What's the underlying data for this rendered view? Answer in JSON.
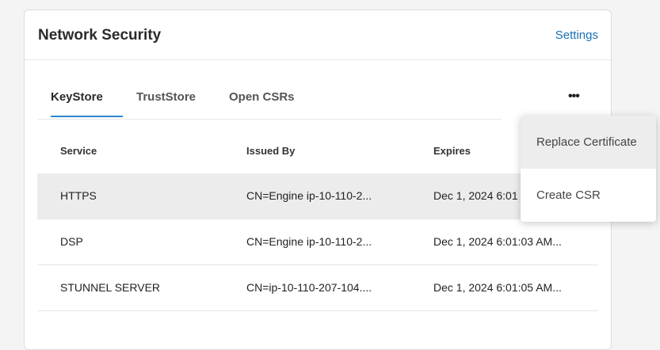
{
  "card": {
    "title": "Network Security",
    "settings_label": "Settings"
  },
  "tabs": [
    {
      "label": "KeyStore",
      "active": true
    },
    {
      "label": "TrustStore",
      "active": false
    },
    {
      "label": "Open CSRs",
      "active": false
    }
  ],
  "more_icon": "more-horizontal-icon",
  "table": {
    "columns": [
      "Service",
      "Issued By",
      "Expires"
    ],
    "rows": [
      {
        "service": "HTTPS",
        "issued_by": "CN=Engine ip-10-110-2...",
        "expires": "Dec 1, 2024 6:01"
      },
      {
        "service": "DSP",
        "issued_by": "CN=Engine ip-10-110-2...",
        "expires": "Dec 1, 2024 6:01:03 AM..."
      },
      {
        "service": "STUNNEL SERVER",
        "issued_by": "CN=ip-10-110-207-104....",
        "expires": "Dec 1, 2024 6:01:05 AM..."
      }
    ]
  },
  "menu": {
    "items": [
      "Replace Certificate",
      "Create CSR"
    ]
  },
  "colors": {
    "accent": "#1a6fb5",
    "tab_underline": "#2f86d1",
    "row_highlight": "#ececec"
  }
}
